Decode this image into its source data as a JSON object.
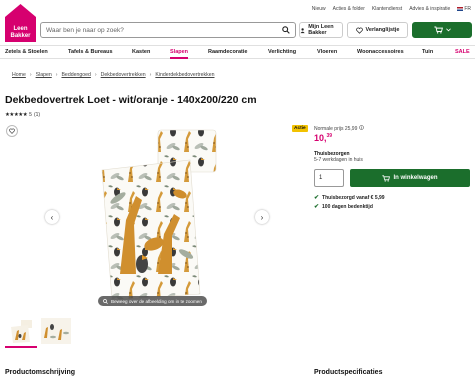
{
  "topbar": {
    "links": [
      "Nieuw",
      "Acties & folder",
      "Klantendienst",
      "Advies & inspiratie"
    ],
    "language": "FR"
  },
  "brand": {
    "line1": "Leen",
    "line2": "Bakker",
    "color": "#d6006f"
  },
  "search": {
    "placeholder": "Waar ben je naar op zoek?"
  },
  "header_buttons": {
    "account": "Mijn Leen Bakker",
    "wishlist": "Verlanglijstje"
  },
  "nav": {
    "items": [
      "Zetels & Stoelen",
      "Tafels & Bureaus",
      "Kasten",
      "Slapen",
      "Raamdecoratie",
      "Verlichting",
      "Vloeren",
      "Woonaccessoires",
      "Tuin",
      "SALE"
    ],
    "active": "Slapen"
  },
  "breadcrumb": [
    "Home",
    "Slapen",
    "Beddengoed",
    "Dekbedovertrekken",
    "Kinderdekbedovertrekken"
  ],
  "product": {
    "title": "Dekbedovertrek Loet - wit/oranje - 140x200/220 cm",
    "stars": "★★★★★",
    "rating_value": "5",
    "review_count": "(1)"
  },
  "gallery": {
    "zoom_hint": "Beweeg over de afbeelding om in te zoomen",
    "thumbnail_count": 2
  },
  "buybox": {
    "badge": "Actie",
    "normal_price": "Normale prijs 25,99",
    "price_main": "10,",
    "price_cents": "39",
    "delivery_title": "Thuisbezorgen",
    "delivery_time": "5-7 werkdagen in huis",
    "quantity": "1",
    "add_to_cart": "In winkelwagen",
    "usps": [
      "Thuisbezorgd vanaf € 5,99",
      "100 dagen bedenktijd"
    ]
  },
  "sections": {
    "description": "Productomschrijving",
    "specs": "Productspecificaties"
  },
  "colors": {
    "accent": "#d6006f",
    "cta": "#1b6e2c",
    "badge": "#f2c200"
  }
}
